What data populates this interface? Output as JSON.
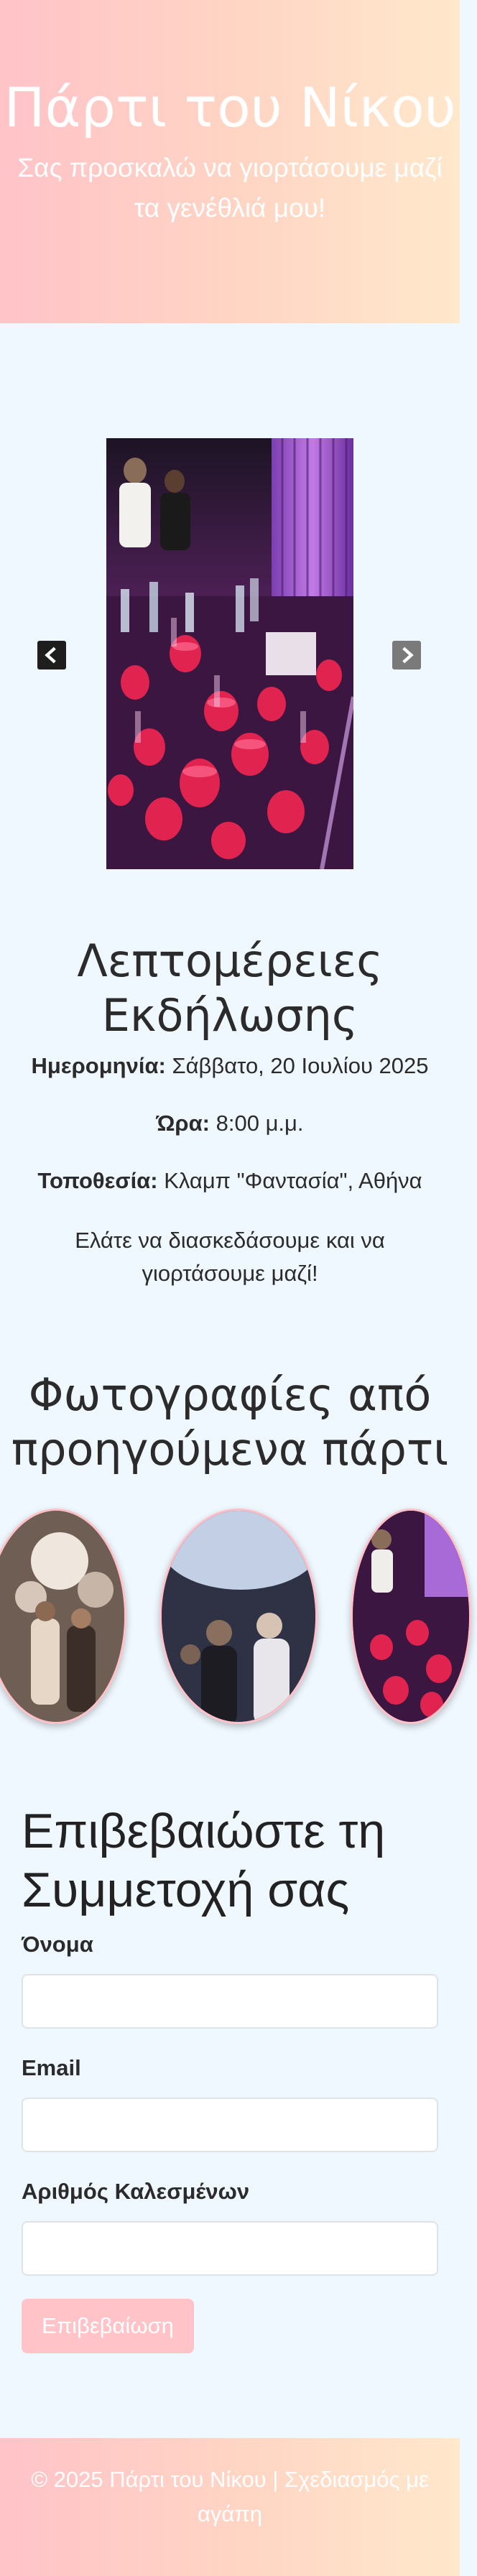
{
  "header": {
    "title": "Πάρτι του Νίκου",
    "subtitle": "Σας προσκαλώ να γιορτάσουμε μαζί τα γενέθλιά μου!"
  },
  "carousel": {
    "prev_icon": "chevron-left-icon",
    "next_icon": "chevron-right-icon"
  },
  "details": {
    "title": "Λεπτομέρειες Εκδήλωσης",
    "date_label": "Ημερομηνία:",
    "date_value": "Σάββατο, 20 Ιουλίου 2025",
    "time_label": "Ώρα:",
    "time_value": "8:00 μ.μ.",
    "location_label": "Τοποθεσία:",
    "location_value": "Κλαμπ \"Φαντασία\", Αθήνα",
    "note": "Ελάτε να διασκεδάσουμε και να γιορτάσουμε μαζί!"
  },
  "gallery": {
    "title": "Φωτογραφίες από προηγούμενα πάρτι"
  },
  "rsvp": {
    "title": "Επιβεβαιώστε τη Συμμετοχή σας",
    "name_label": "Όνομα",
    "name_value": "",
    "email_label": "Email",
    "email_value": "",
    "guests_label": "Αριθμός Καλεσμένων",
    "guests_value": "",
    "submit_label": "Επιβεβαίωση"
  },
  "footer": {
    "text": "© 2025 Πάρτι του Νίκου | Σχεδιασμός με αγάπη"
  },
  "colors": {
    "page_background": "#f0f8ff",
    "accent_pink": "#ffc3c8",
    "accent_peach": "#ffe8cc"
  }
}
